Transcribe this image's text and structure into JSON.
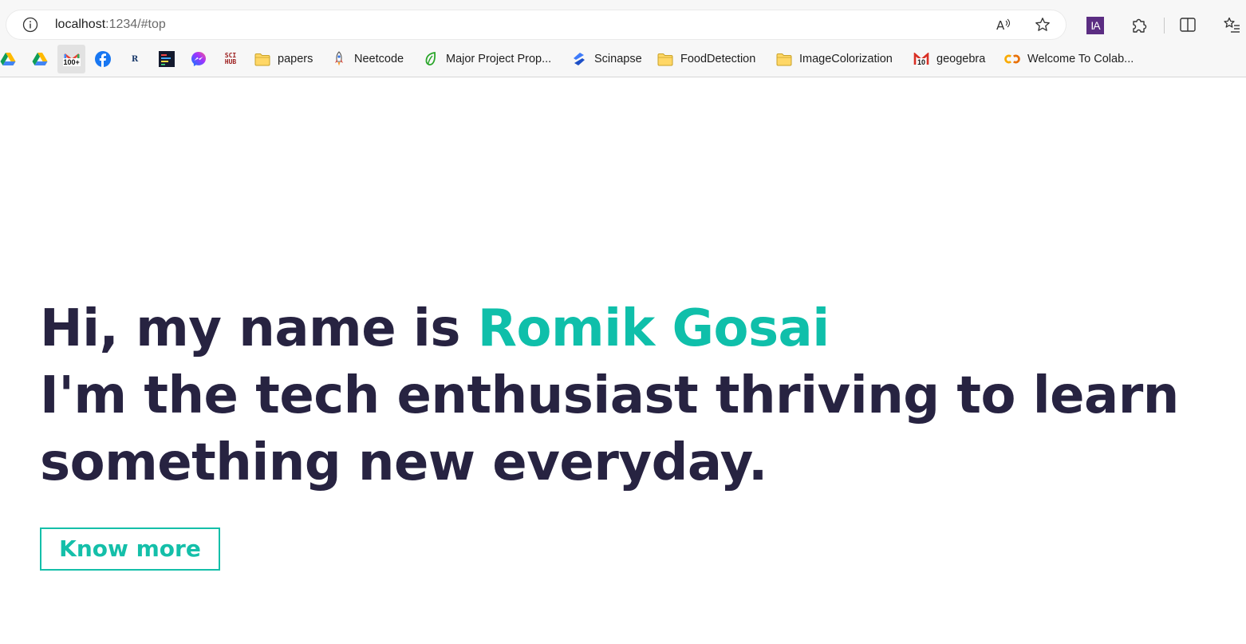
{
  "browser": {
    "url_host": "localhost",
    "url_path": ":1234/#top",
    "toolbar_icons": [
      "read-aloud-icon",
      "favorite-star-icon",
      "ia-extension-icon",
      "extensions-puzzle-icon",
      "split-screen-icon",
      "favorites-list-icon"
    ],
    "ia_label": "IA"
  },
  "bookmarks": [
    {
      "icon": "google-drive-icon",
      "label": ""
    },
    {
      "icon": "google-drive-icon",
      "label": ""
    },
    {
      "icon": "gmail-icon",
      "label": "",
      "badge": "100+"
    },
    {
      "icon": "facebook-icon",
      "label": ""
    },
    {
      "icon": "researchgate-icon",
      "label": "",
      "glyph": "R"
    },
    {
      "icon": "terminal-app-icon",
      "label": ""
    },
    {
      "icon": "messenger-icon",
      "label": ""
    },
    {
      "icon": "sci-hub-icon",
      "label": "",
      "glyph_top": "SCI",
      "glyph_bottom": "HUB"
    },
    {
      "icon": "folder-icon",
      "label": "papers"
    },
    {
      "icon": "rocket-icon",
      "label": "Neetcode"
    },
    {
      "icon": "leaf-icon",
      "label": "Major Project Prop..."
    },
    {
      "icon": "scinapse-icon",
      "label": "Scinapse"
    },
    {
      "icon": "folder-icon",
      "label": "FoodDetection"
    },
    {
      "icon": "folder-icon",
      "label": "ImageColorization"
    },
    {
      "icon": "gmail-icon",
      "label": "geogebra",
      "badge": "10"
    },
    {
      "icon": "colab-icon",
      "label": "Welcome To Colab..."
    }
  ],
  "hero": {
    "greeting": "Hi, my name is ",
    "name": "Romik Gosai",
    "line2": "I'm the tech enthusiast thriving to learn",
    "line3": "something new everyday.",
    "cta_label": "Know more"
  },
  "colors": {
    "heading": "#272341",
    "accent": "#0fbfaa",
    "button_border": "#14bfa9"
  }
}
